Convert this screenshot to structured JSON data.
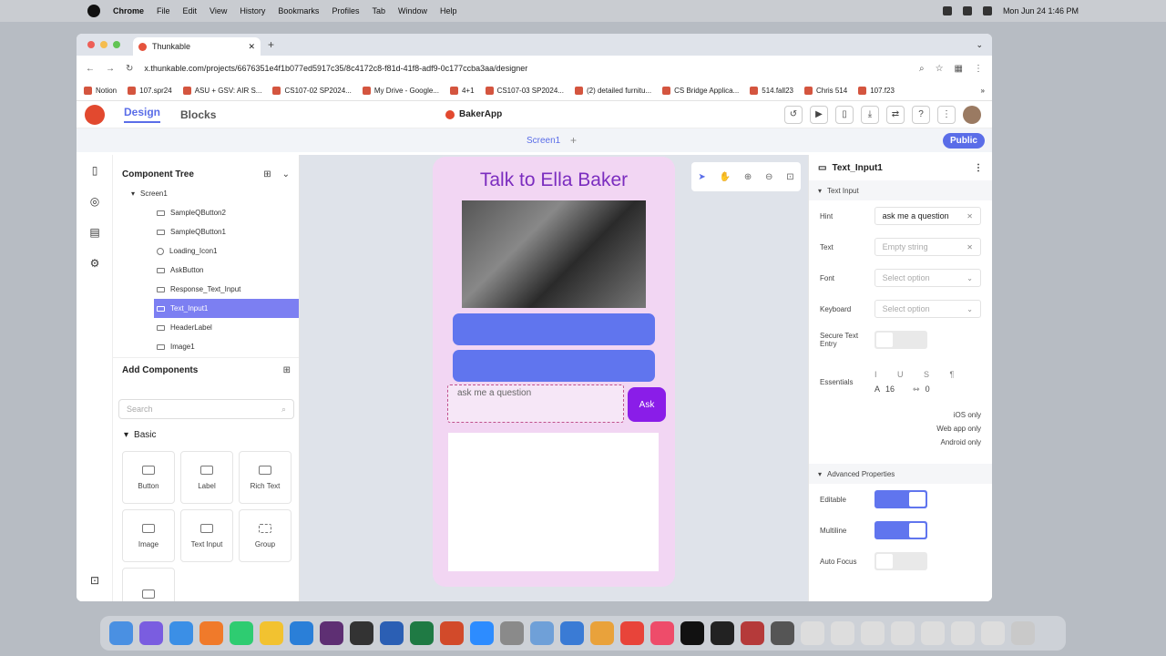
{
  "menubar": {
    "app": "Chrome",
    "items": [
      "File",
      "Edit",
      "View",
      "History",
      "Bookmarks",
      "Profiles",
      "Tab",
      "Window",
      "Help"
    ],
    "clock": "Mon Jun 24  1:46 PM"
  },
  "browser": {
    "tab_title": "Thunkable",
    "url": "x.thunkable.com/projects/6676351e4f1b077ed5917c35/8c4172c8-f81d-41f8-adf9-0c177ccba3aa/designer",
    "bookmarks": [
      "Notion",
      "107.spr24",
      "ASU + GSV: AIR S...",
      "CS107-02 SP2024...",
      "My Drive - Google...",
      "4+1",
      "CS107-03 SP2024...",
      "(2) detailed furnitu...",
      "CS Bridge Applica...",
      "514.fall23",
      "Chris 514",
      "107.f23"
    ]
  },
  "app": {
    "tab_design": "Design",
    "tab_blocks": "Blocks",
    "project": "BakerApp",
    "screen": "Screen1",
    "publish": "Public"
  },
  "component_tree": {
    "title": "Component Tree",
    "root": "Screen1",
    "items": [
      "SampleQButton2",
      "SampleQButton1",
      "Loading_Icon1",
      "AskButton",
      "Response_Text_Input",
      "Text_Input1",
      "HeaderLabel",
      "Image1"
    ]
  },
  "add_components": {
    "title": "Add Components",
    "search_placeholder": "Search",
    "category": "Basic",
    "cards": [
      "Button",
      "Label",
      "Rich Text",
      "Image",
      "Text Input",
      "Group"
    ]
  },
  "phone": {
    "title": "Talk to Ella Baker",
    "input_hint": "ask me a question",
    "ask_label": "Ask"
  },
  "props": {
    "component": "Text_Input1",
    "section": "Text Input",
    "hint_label": "Hint",
    "hint_value": "ask me a question",
    "text_label": "Text",
    "text_placeholder": "Empty string",
    "font_label": "Font",
    "font_placeholder": "Select option",
    "keyboard_label": "Keyboard",
    "keyboard_placeholder": "Select option",
    "secure_label": "Secure Text Entry",
    "essentials_label": "Essentials",
    "font_size": "16",
    "letter_spacing": "0",
    "notes": [
      "iOS only",
      "Web app only",
      "Android only"
    ],
    "advanced": "Advanced Properties",
    "editable_label": "Editable",
    "multiline_label": "Multiline",
    "autofocus_label": "Auto Focus"
  }
}
